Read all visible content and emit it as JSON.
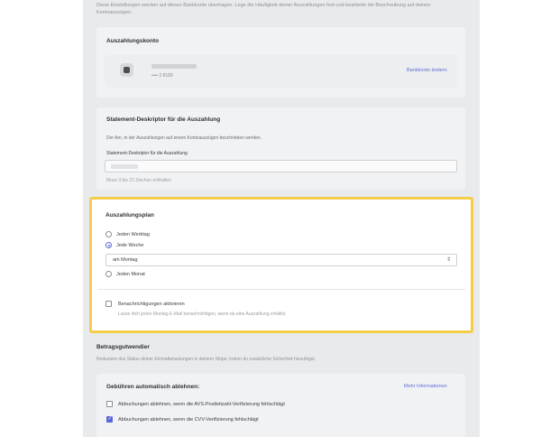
{
  "intro_text": "Diese Einstellungen werden auf dieses Bankkonto übertragen. Lege die Häufigkeit deiner Auszahlungen fest und bearbeite die Beschreibung auf deinen Kontoauszügen.",
  "payout_account": {
    "title": "Auszahlungskonto",
    "masked_number": "•••• 3 8189",
    "change_link": "Bankkonto ändern"
  },
  "descriptor": {
    "title": "Statement-Deskriptor für die Auszahlung",
    "description": "Der Am, in der Auszahlungen auf einem Kontoauszügen beschrieben werden.",
    "field_label": "Statement-Deskriptor für die Auszahlung",
    "field_value": "",
    "hint": "Muss 3 bis 22 Zeichen enthalten"
  },
  "schedule": {
    "title": "Auszahlungsplan",
    "options": [
      "Jeden Werktag",
      "Jede Woche",
      "Jeden Monat"
    ],
    "selected_index": 1,
    "day_select": "am Montag",
    "notify_label": "Benachrichtigungen aktivieren",
    "notify_desc": "Lasse dich jeden Montag E-Mail benachrichtigen, wenn du eine Auszahlung erhältst",
    "notify_checked": false
  },
  "debit": {
    "title": "Betragsgutwendier",
    "desc": "Reduziere des Status deiner Einmalbelastungen in deinem Stripe, indem du zusätzliche Sicherheit hinzufügst."
  },
  "auto_decline": {
    "title": "Gebühren automatisch ablehnen:",
    "more_link": "Mehr Informationen",
    "items": [
      {
        "label": "Abbuchungen ablehnen, wenn die AVS-Postleitzahl-Verifizierung fehlschlägt",
        "checked": false
      },
      {
        "label": "Abbuchungen ablehnen, wenn die CVV-Verifizierung fehlschlägt",
        "checked": true
      }
    ]
  },
  "colors": {
    "accent": "#5a67d8",
    "highlight": "#f5cd4a"
  }
}
